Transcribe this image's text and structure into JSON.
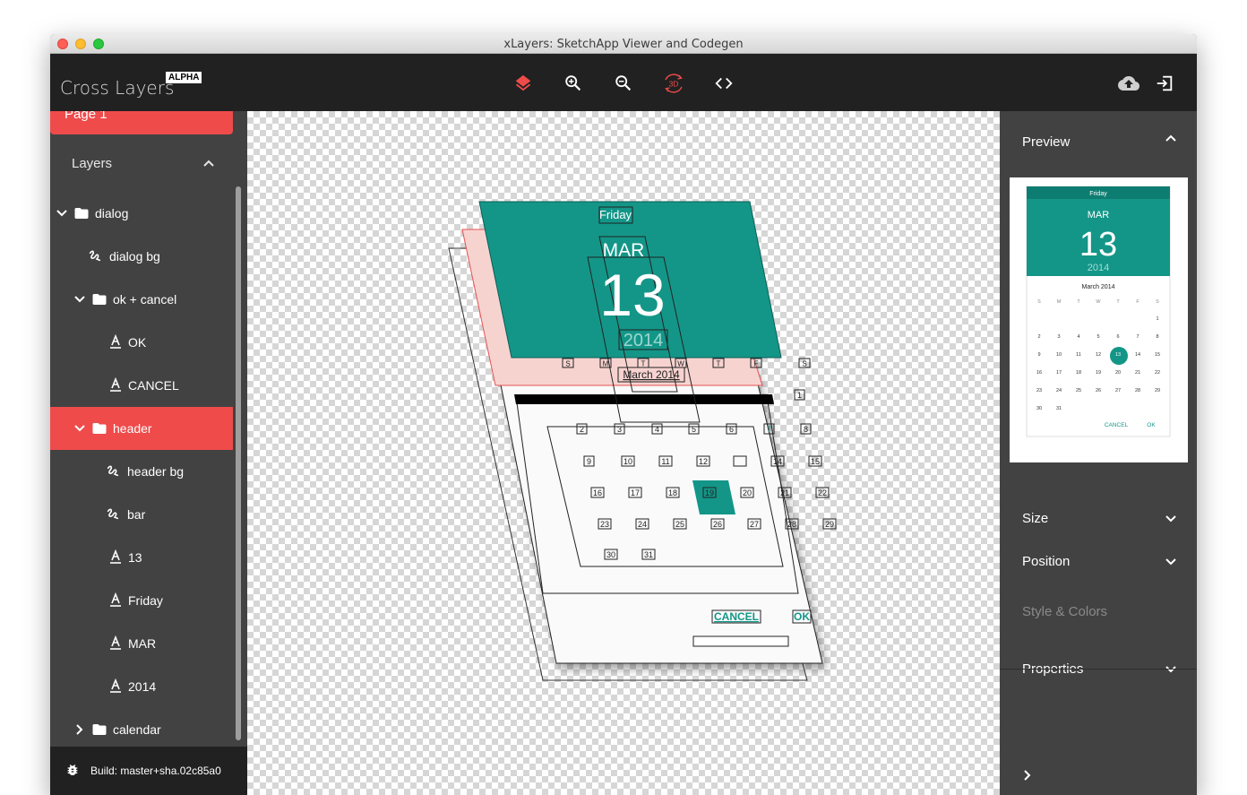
{
  "window": {
    "title": "xLayers: SketchApp Viewer and Codegen"
  },
  "toolbar": {
    "brand": "Cross Layers",
    "badge": "ALPHA",
    "tools": [
      {
        "name": "layers-icon",
        "active": true
      },
      {
        "name": "zoom-in-icon"
      },
      {
        "name": "zoom-out-icon"
      },
      {
        "name": "3d-rotate-icon",
        "label": "3D",
        "active": true
      },
      {
        "name": "code-icon"
      }
    ],
    "right_tools": [
      {
        "name": "cloud-upload-icon"
      },
      {
        "name": "exit-icon"
      }
    ]
  },
  "sidebar": {
    "page_tab": "Page 1",
    "layers_title": "Layers",
    "tree": [
      {
        "label": "dialog",
        "type": "folder",
        "expanded": true,
        "level": 0
      },
      {
        "label": "dialog bg",
        "type": "shape",
        "level": 1
      },
      {
        "label": "ok + cancel",
        "type": "folder",
        "expanded": true,
        "level": 1
      },
      {
        "label": "OK",
        "type": "text",
        "level": 2
      },
      {
        "label": "CANCEL",
        "type": "text",
        "level": 2
      },
      {
        "label": "header",
        "type": "folder",
        "expanded": true,
        "level": 1,
        "active": true
      },
      {
        "label": "header bg",
        "type": "shape",
        "level": 2
      },
      {
        "label": "bar",
        "type": "shape",
        "level": 2
      },
      {
        "label": "13",
        "type": "text",
        "level": 2
      },
      {
        "label": "Friday",
        "type": "text",
        "level": 2
      },
      {
        "label": "MAR",
        "type": "text",
        "level": 2
      },
      {
        "label": "2014",
        "type": "text",
        "level": 2
      },
      {
        "label": "calendar",
        "type": "folder",
        "expanded": false,
        "level": 1
      }
    ],
    "build": "Build: master+sha.02c85a0"
  },
  "canvas": {
    "header_day": "Friday",
    "header_month": "MAR",
    "header_date": "13",
    "header_year": "2014",
    "month_label": "March 2014",
    "weekdays": [
      "S",
      "M",
      "T",
      "W",
      "T",
      "F",
      "S"
    ],
    "days": [
      "1",
      "2",
      "3",
      "4",
      "5",
      "6",
      "7",
      "8",
      "9",
      "10",
      "11",
      "12",
      "13",
      "14",
      "15",
      "16",
      "17",
      "18",
      "19",
      "20",
      "21",
      "22",
      "23",
      "24",
      "25",
      "26",
      "27",
      "28",
      "29",
      "30",
      "31"
    ],
    "cancel": "CANCEL",
    "ok": "OK",
    "colors": {
      "teal": "#139688",
      "pink": "#f7d3d0",
      "red": "#ef4b4b"
    }
  },
  "right_panel": {
    "preview_title": "Preview",
    "sections": [
      {
        "label": "Size",
        "enabled": true
      },
      {
        "label": "Position",
        "enabled": true
      },
      {
        "label": "Style & Colors",
        "enabled": false
      },
      {
        "label": "Properties",
        "enabled": true
      }
    ],
    "preview": {
      "day": "Friday",
      "month": "MAR",
      "date": "13",
      "year": "2014",
      "month_label": "March 2014",
      "weekdays": [
        "S",
        "M",
        "T",
        "W",
        "T",
        "F",
        "S"
      ],
      "weeks": [
        [
          "",
          "",
          "",
          "",
          "",
          "",
          "1"
        ],
        [
          "2",
          "3",
          "4",
          "5",
          "6",
          "7",
          "8"
        ],
        [
          "9",
          "10",
          "11",
          "12",
          "13",
          "14",
          "15"
        ],
        [
          "16",
          "17",
          "18",
          "19",
          "20",
          "21",
          "22"
        ],
        [
          "23",
          "24",
          "25",
          "26",
          "27",
          "28",
          "29"
        ],
        [
          "30",
          "31",
          "",
          "",
          "",
          "",
          ""
        ]
      ],
      "selected": "13",
      "cancel": "CANCEL",
      "ok": "OK"
    }
  }
}
